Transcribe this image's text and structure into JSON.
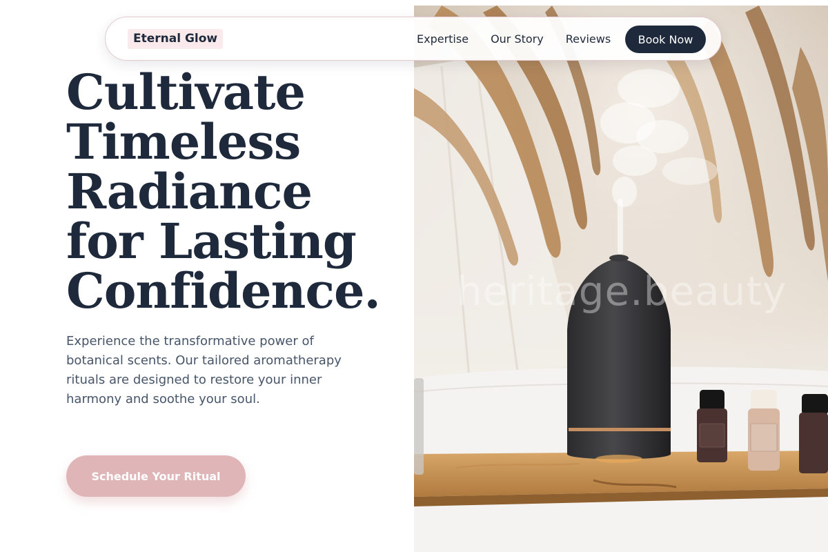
{
  "brand": {
    "name": "Eternal Glow"
  },
  "nav": {
    "links": [
      "Expertise",
      "Our Story",
      "Reviews"
    ],
    "cta_label": "Book Now"
  },
  "hero": {
    "headline_lines": [
      "Cultivate",
      "Timeless",
      "Radiance",
      "for Lasting",
      "Confidence."
    ],
    "description": "Experience the transformative power of botanical scents. Our tailored aromatherapy rituals are designed to restore your inner harmony and soothe your soul.",
    "cta_label": "Schedule Your Ritual",
    "image_watermark": "heritage.beauty"
  },
  "colors": {
    "primary_text": "#1e293b",
    "body_text": "#475569",
    "accent_pink": "#e0b5b7",
    "logo_bg": "#fbeaec",
    "dark_button": "#1e293b"
  },
  "icons": [
    "aroma-diffuser",
    "essential-oil-bottle",
    "pampas-grass",
    "steam-mist"
  ]
}
